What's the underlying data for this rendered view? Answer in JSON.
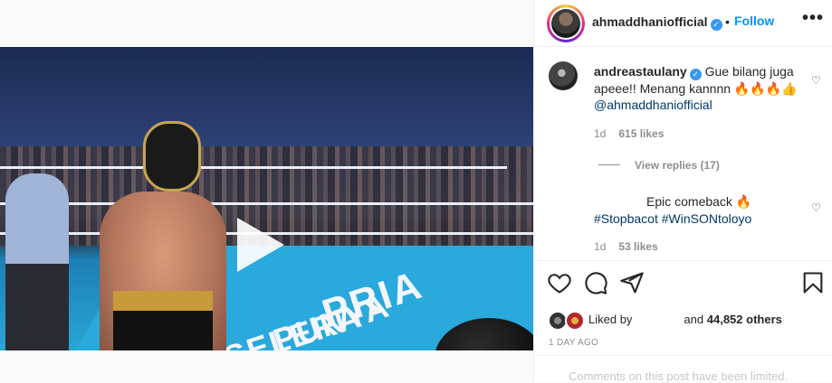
{
  "post": {
    "author": "ahmaddhaniofficial",
    "separator": "•",
    "follow_label": "Follow",
    "more_label": "•••"
  },
  "media": {
    "mat_text_1": "PRIA",
    "mat_text_2": "PUNYA",
    "mat_text_3": "SELERA"
  },
  "comments": [
    {
      "username": "andreastaulany",
      "text": "Gue bilang juga apeee!! Menang kannnn 🔥🔥🔥👍",
      "mention": "@ahmaddhaniofficial",
      "time": "1d",
      "likes": "615 likes",
      "view_replies": "View replies (17)"
    },
    {
      "username": "",
      "text": "Epic comeback 🔥",
      "hashtags": "#Stopbacot #WinSONtoloyo",
      "time": "1d",
      "likes": "53 likes"
    }
  ],
  "likes": {
    "prefix": "Liked by",
    "middle": "and",
    "count": "44,852 others"
  },
  "date": "1 DAY AGO",
  "limited_notice": "Comments on this post have been limited.",
  "colors": {
    "accent": "#0095f6",
    "verified": "#3897f0",
    "muted": "#8e8e8e",
    "mention": "#00376b"
  }
}
